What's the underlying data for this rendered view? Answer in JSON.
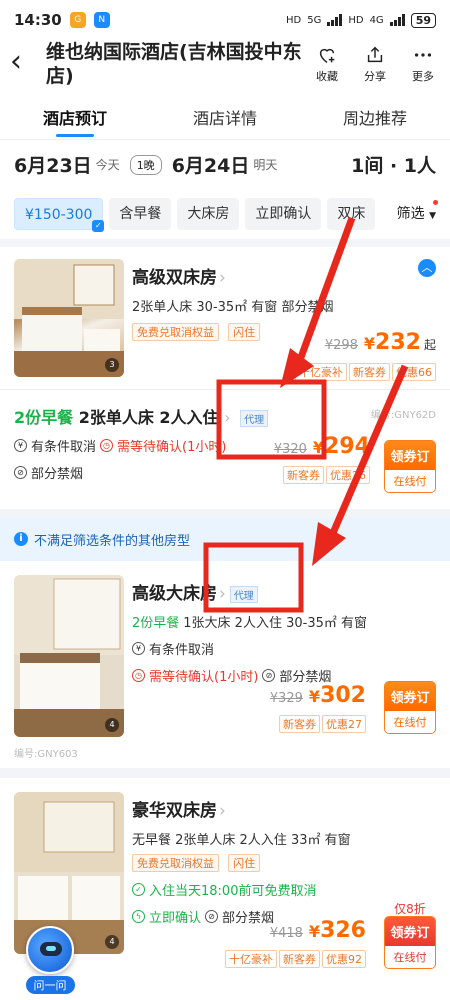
{
  "status_bar": {
    "time": "14:30",
    "battery": "59",
    "net1": "5G",
    "net2": "4G"
  },
  "header": {
    "title": "维也纳国际酒店(吉林国投中东店)",
    "actions": [
      {
        "label": "收藏",
        "icon": "heart-plus-icon"
      },
      {
        "label": "分享",
        "icon": "share-icon"
      },
      {
        "label": "更多",
        "icon": "more-icon"
      }
    ]
  },
  "tabs": [
    {
      "label": "酒店预订",
      "active": true
    },
    {
      "label": "酒店详情",
      "active": false
    },
    {
      "label": "周边推荐",
      "active": false
    }
  ],
  "dates": {
    "checkin": "6月23日",
    "checkin_day": "今天",
    "nights": "1晚",
    "checkout": "6月24日",
    "checkout_day": "明天",
    "rooms": "1间 · 1人"
  },
  "filters": {
    "chips": [
      "¥150-300",
      "含早餐",
      "大床房",
      "立即确认",
      "双床"
    ],
    "filter_label": "筛选"
  },
  "room1": {
    "name": "高级双床房",
    "spec": "2张单人床  30-35㎡  有窗  部分禁烟",
    "tags": [
      "免费兑取消权益",
      "闪住"
    ],
    "original_price": "¥298",
    "currency": "¥",
    "price": "232",
    "suffix": "起",
    "promos": [
      "十亿豪补",
      "新客券",
      "优惠66"
    ],
    "image_count": "3"
  },
  "plan1": {
    "breakfast": "2份早餐",
    "title_rest": "2张单人床  2人入住",
    "agent": "代理",
    "code": "编号:GNY62D",
    "cancel": "有条件取消",
    "confirm": "需等待确认(1小时)",
    "smoke": "部分禁烟",
    "original_price": "¥320",
    "currency": "¥",
    "price": "294",
    "promos": [
      "新客券",
      "优惠26"
    ],
    "book_top": "领券订",
    "book_bottom": "在线付"
  },
  "notice": {
    "text": "不满足筛选条件的其他房型"
  },
  "room2": {
    "name": "高级大床房",
    "agent": "代理",
    "breakfast": "2份早餐",
    "spec": "1张大床  2人入住  30-35㎡  有窗",
    "cancel": "有条件取消",
    "confirm": "需等待确认(1小时)",
    "smoke": "部分禁烟",
    "original_price": "¥329",
    "currency": "¥",
    "price": "302",
    "promos": [
      "新客券",
      "优惠27"
    ],
    "book_top": "领券订",
    "book_bottom": "在线付",
    "code": "编号:GNY603",
    "image_count": "4"
  },
  "room3": {
    "name": "豪华双床房",
    "spec": "无早餐  2张单人床  2人入住  33㎡  有窗",
    "tags": [
      "免费兑取消权益",
      "闪住"
    ],
    "free_cancel": "入住当天18:00前可免费取消",
    "instant": "立即确认",
    "smoke": "部分禁烟",
    "discount": "仅8折",
    "original_price": "¥418",
    "currency": "¥",
    "price": "326",
    "promos": [
      "十亿豪补",
      "新客券",
      "优惠92"
    ],
    "book_top": "领券订",
    "book_bottom": "在线付",
    "image_count": "4"
  },
  "ask": {
    "label": "问一问"
  },
  "colors": {
    "accent": "#1a8cff",
    "price": "#ff6a00",
    "annotation": "#e8281c",
    "green": "#1ab34a"
  }
}
